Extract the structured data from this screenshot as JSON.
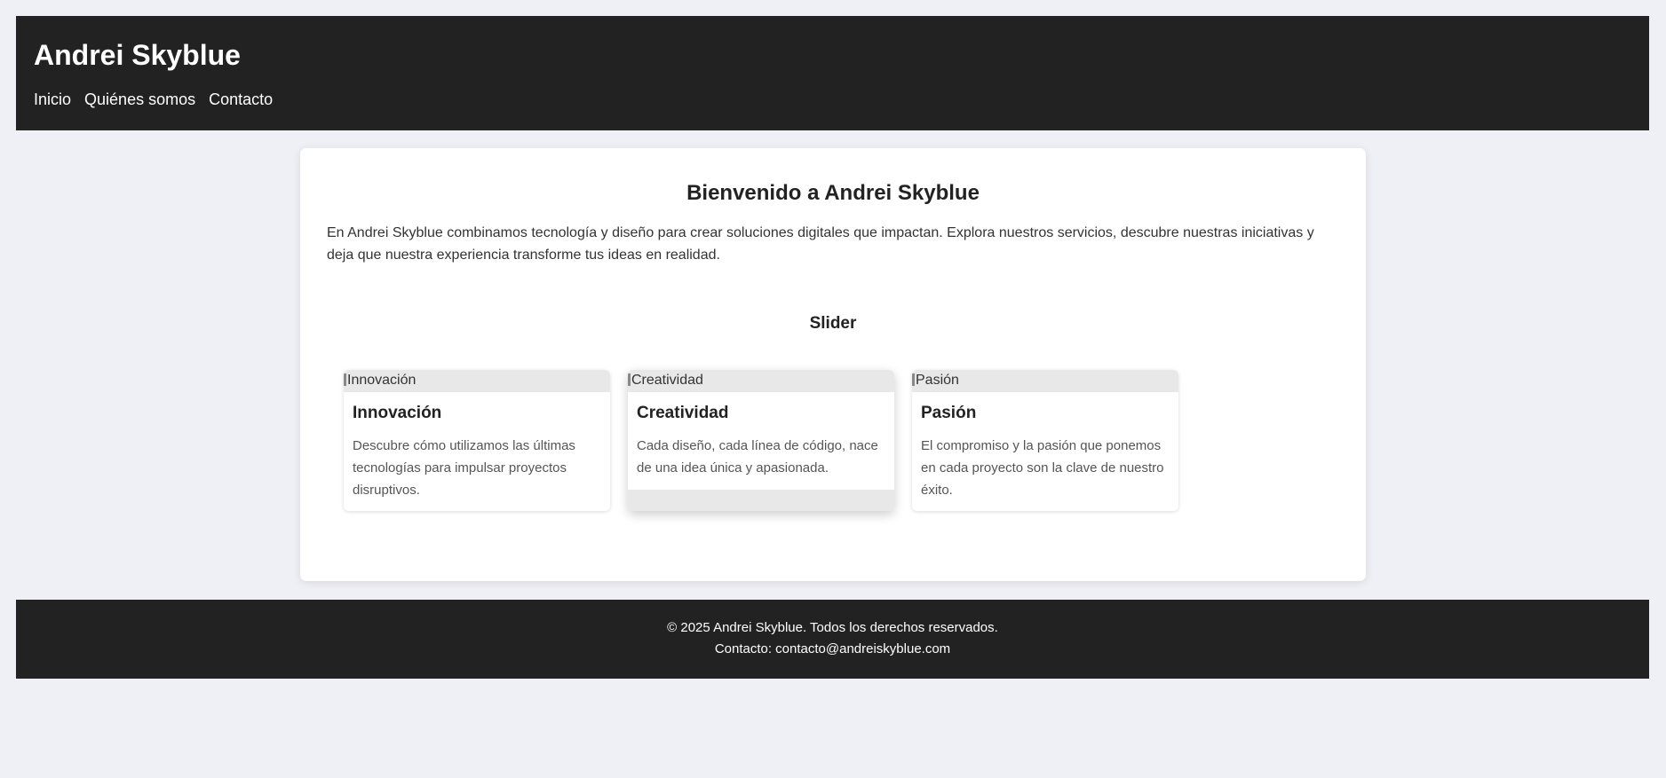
{
  "header": {
    "title": "Andrei Skyblue",
    "nav": [
      {
        "label": "Inicio"
      },
      {
        "label": "Quiénes somos"
      },
      {
        "label": "Contacto"
      }
    ]
  },
  "main": {
    "title": "Bienvenido a Andrei Skyblue",
    "intro": "En Andrei Skyblue combinamos tecnología y diseño para crear soluciones digitales que impactan. Explora nuestros servicios, descubre nuestras iniciativas y deja que nuestra experiencia transforme tus ideas en realidad.",
    "slider_title": "Slider",
    "slides": [
      {
        "image_alt": "Innovación",
        "title": "Innovación",
        "text": "Descubre cómo utilizamos las últimas tecnologías para impulsar proyectos disruptivos."
      },
      {
        "image_alt": "Creatividad",
        "title": "Creatividad",
        "text": "Cada diseño, cada línea de código, nace de una idea única y apasionada."
      },
      {
        "image_alt": "Pasión",
        "title": "Pasión",
        "text": "El compromiso y la pasión que ponemos en cada proyecto son la clave de nuestro éxito."
      }
    ]
  },
  "footer": {
    "copyright": "© 2025 Andrei Skyblue. Todos los derechos reservados.",
    "contact": "Contacto: contacto@andreiskyblue.com"
  },
  "colors": {
    "page_background": "#eff0f5",
    "header_background": "#222222",
    "card_background": "#ffffff",
    "image_placeholder": "#e8e8e8"
  }
}
